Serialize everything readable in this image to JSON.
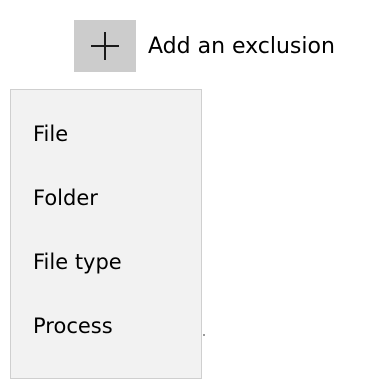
{
  "add_exclusion": {
    "icon": "plus-icon",
    "label": "Add an exclusion"
  },
  "menu": {
    "items": [
      {
        "label": "File"
      },
      {
        "label": "Folder"
      },
      {
        "label": "File type"
      },
      {
        "label": "Process"
      }
    ]
  },
  "colors": {
    "button_background": "#cccccc",
    "menu_background": "#f2f2f2",
    "menu_border": "#cfcfcf",
    "text": "#000000"
  }
}
